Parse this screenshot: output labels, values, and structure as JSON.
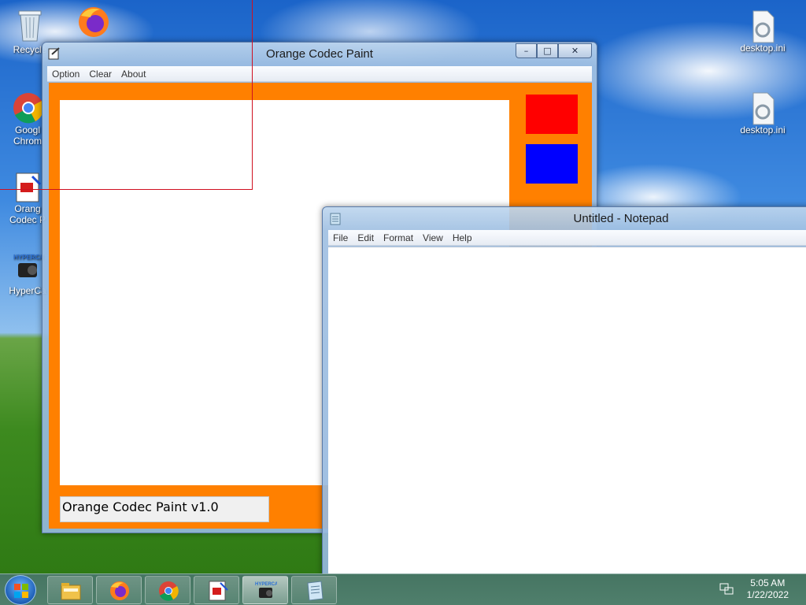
{
  "desktop": {
    "icons": [
      {
        "label": "Recycle",
        "icon": "recycle-bin-icon"
      },
      {
        "label": "Googl Chrom",
        "icon": "chrome-icon"
      },
      {
        "label": "Orang Codec P",
        "icon": "orange-codec-paint-icon"
      },
      {
        "label": "HyperCa",
        "icon": "hypercam-icon"
      },
      {
        "label": "desktop.ini",
        "icon": "settings-file-icon"
      },
      {
        "label": "desktop.ini",
        "icon": "settings-file-icon"
      }
    ]
  },
  "paint_window": {
    "title": "Orange Codec Paint",
    "menu": [
      "Option",
      "Clear",
      "About"
    ],
    "status_text": "Orange Codec Paint v1.0",
    "colors": {
      "background": "#ff8000",
      "swatch1": "#ff0000",
      "swatch2": "#0000ff"
    },
    "controls": {
      "minimize": "–",
      "maximize": "□",
      "close": "✕"
    }
  },
  "notepad_window": {
    "title": "Untitled - Notepad",
    "menu": [
      "File",
      "Edit",
      "Format",
      "View",
      "Help"
    ]
  },
  "taskbar": {
    "items": [
      {
        "icon": "file-explorer-icon",
        "active": false
      },
      {
        "icon": "firefox-icon",
        "active": false
      },
      {
        "icon": "chrome-icon",
        "active": false
      },
      {
        "icon": "orange-codec-paint-icon",
        "active": false
      },
      {
        "icon": "hypercam-icon",
        "active": true
      },
      {
        "icon": "notepad-icon",
        "active": false
      }
    ],
    "clock": {
      "time": "5:05 AM",
      "date": "1/22/2022"
    }
  }
}
